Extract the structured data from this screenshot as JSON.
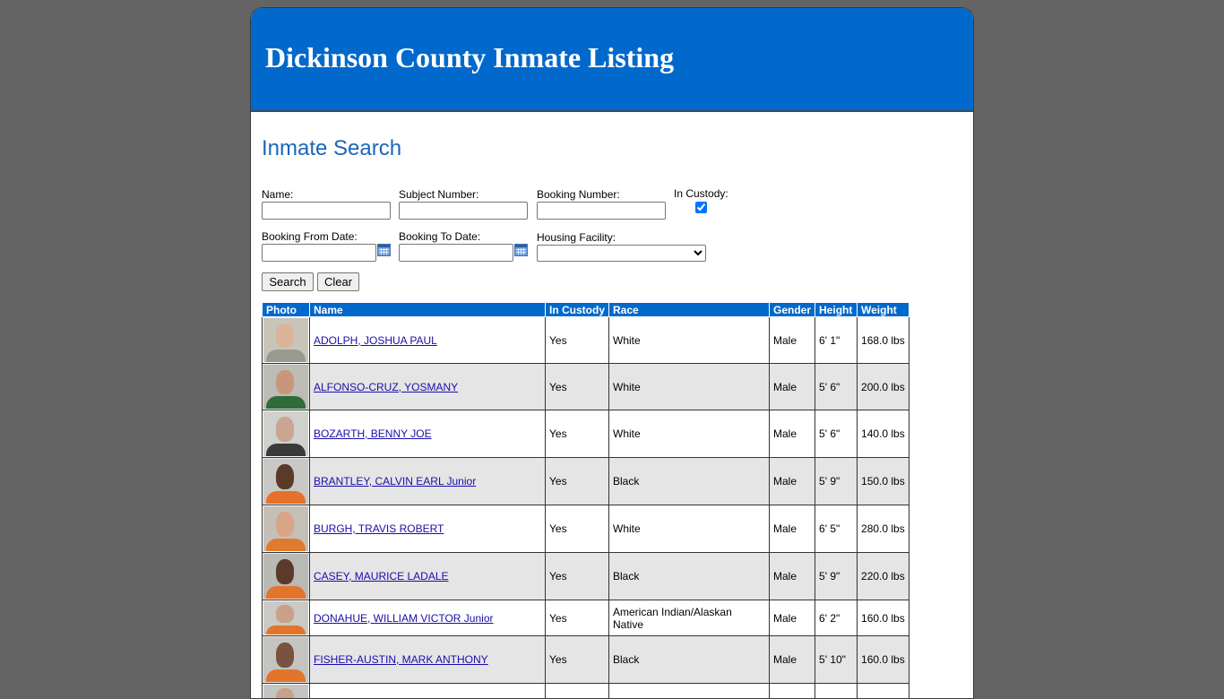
{
  "header": {
    "title": "Dickinson County Inmate Listing"
  },
  "search": {
    "title": "Inmate Search",
    "name_label": "Name:",
    "subject_label": "Subject Number:",
    "booking_label": "Booking Number:",
    "custody_label": "In Custody:",
    "custody_checked": true,
    "from_label": "Booking From Date:",
    "to_label": "Booking To Date:",
    "facility_label": "Housing Facility:",
    "facility_value": "",
    "search_button": "Search",
    "clear_button": "Clear"
  },
  "table": {
    "headers": [
      "Photo",
      "Name",
      "In Custody",
      "Race",
      "Gender",
      "Height",
      "Weight"
    ],
    "rows": [
      {
        "name": "ADOLPH, JOSHUA PAUL",
        "custody": "Yes",
        "race": "White",
        "gender": "Male",
        "height": "6' 1\"",
        "weight": "168.0 lbs",
        "bg": "#c9c4b8",
        "skin": "#d9b49a",
        "shirt": "#9a9a8e"
      },
      {
        "name": "ALFONSO-CRUZ, YOSMANY",
        "custody": "Yes",
        "race": "White",
        "gender": "Male",
        "height": "5' 6\"",
        "weight": "200.0 lbs",
        "bg": "#bcbcb4",
        "skin": "#c9967c",
        "shirt": "#2f6b3b"
      },
      {
        "name": "BOZARTH, BENNY JOE",
        "custody": "Yes",
        "race": "White",
        "gender": "Male",
        "height": "5' 6\"",
        "weight": "140.0 lbs",
        "bg": "#d0d0cc",
        "skin": "#caa592",
        "shirt": "#3a3a3a"
      },
      {
        "name": "BRANTLEY, CALVIN EARL Junior",
        "custody": "Yes",
        "race": "Black",
        "gender": "Male",
        "height": "5' 9\"",
        "weight": "150.0 lbs",
        "bg": "#c8c8c4",
        "skin": "#5a3b2a",
        "shirt": "#e8702a"
      },
      {
        "name": "BURGH, TRAVIS ROBERT",
        "custody": "Yes",
        "race": "White",
        "gender": "Male",
        "height": "6' 5\"",
        "weight": "280.0 lbs",
        "bg": "#c5c0b6",
        "skin": "#d8a586",
        "shirt": "#e07a30"
      },
      {
        "name": "CASEY, MAURICE LADALE",
        "custody": "Yes",
        "race": "Black",
        "gender": "Male",
        "height": "5' 9\"",
        "weight": "220.0 lbs",
        "bg": "#b9b9b5",
        "skin": "#5c3a2b",
        "shirt": "#e2742c"
      },
      {
        "name": "DONAHUE, WILLIAM VICTOR Junior",
        "custody": "Yes",
        "race": "American Indian/Alaskan Native",
        "gender": "Male",
        "height": "6' 2\"",
        "weight": "160.0 lbs",
        "bg": "#c9c9c5",
        "skin": "#c9a08a",
        "shirt": "#e2742c"
      },
      {
        "name": "FISHER-AUSTIN, MARK ANTHONY",
        "custody": "Yes",
        "race": "Black",
        "gender": "Male",
        "height": "5' 10\"",
        "weight": "160.0 lbs",
        "bg": "#c4c4c0",
        "skin": "#7a5240",
        "shirt": "#e2742c"
      },
      {
        "name": "",
        "custody": "",
        "race": "",
        "gender": "",
        "height": "",
        "weight": "",
        "bg": "#c4c4c0",
        "skin": "#c9a08a",
        "shirt": "#e2742c"
      }
    ]
  }
}
